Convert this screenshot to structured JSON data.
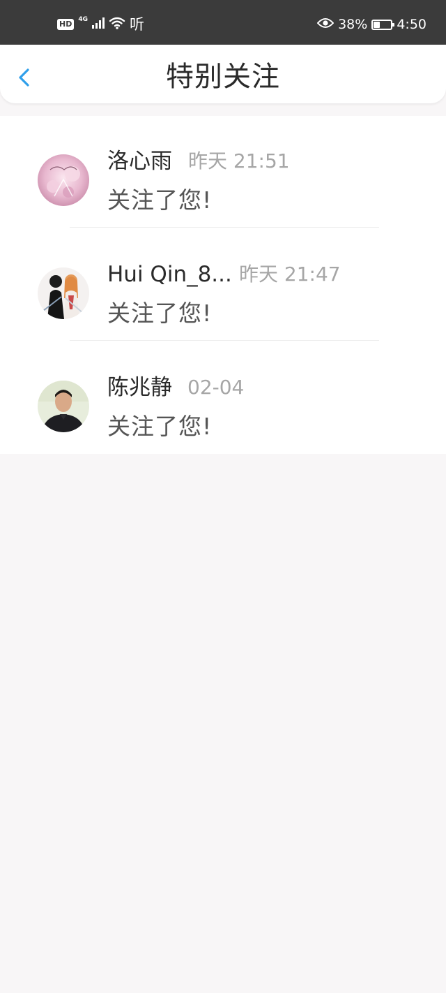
{
  "status_bar": {
    "hd_label": "HD",
    "network_label": "4G",
    "ting_label": "听",
    "battery_percent": "38%",
    "battery_level": 0.38,
    "time": "4:50"
  },
  "header": {
    "back_icon": "chevron-left-icon",
    "title": "特别关注"
  },
  "colors": {
    "accent": "#2f9fea",
    "status_bar_bg": "#3b3b3b",
    "page_bg": "#f8f6f7"
  },
  "items": [
    {
      "name": "洛心雨",
      "time": "昨天 21:51",
      "message": "关注了您!"
    },
    {
      "name": "Hui Qin_8...",
      "time": "昨天 21:47",
      "message": "关注了您!"
    },
    {
      "name": "陈兆静",
      "time": "02-04",
      "message": "关注了您!"
    }
  ]
}
